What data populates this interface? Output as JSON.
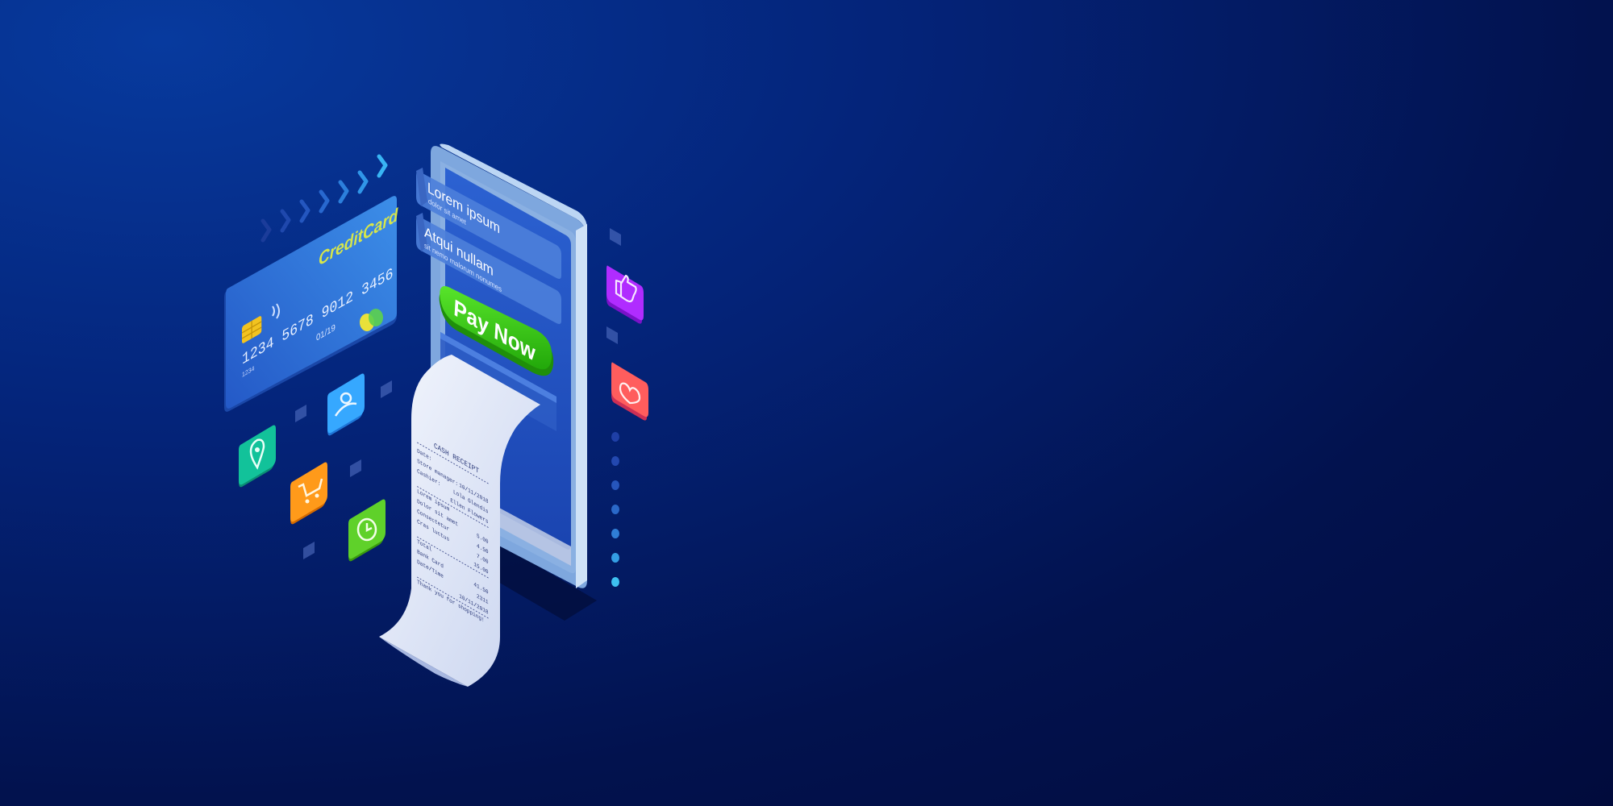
{
  "card": {
    "brand": "CreditCard",
    "number": "1234 5678 9012 3456",
    "expiry": "01/19",
    "small_code": "1234"
  },
  "phone": {
    "field1_title": "Lorem ipsum",
    "field1_sub": "dolor sit amet",
    "field2_title": "Atqui nullam",
    "field2_sub": "sit nemo malorum nonumes",
    "pay_button": "Pay Now"
  },
  "receipt": {
    "title": "CASH RECEIPT",
    "lines": [
      {
        "left": "Date:",
        "right": ""
      },
      {
        "left": "Store manager:",
        "right": "10/11/2018"
      },
      {
        "left": "Cashier:",
        "right": "Lola Glendis"
      },
      {
        "left": "",
        "right": "Ellen Flowers"
      },
      {
        "left": "Lorem ipsum",
        "right": ""
      },
      {
        "left": "Dolor sit amet",
        "right": "5.00"
      },
      {
        "left": "Consectetur",
        "right": "4.50"
      },
      {
        "left": "Cras luctus",
        "right": "7.00"
      },
      {
        "left": "",
        "right": "15.00"
      },
      {
        "left": "Total",
        "right": ""
      },
      {
        "left": "Bank Card",
        "right": "41.50"
      },
      {
        "left": "Date/Time",
        "right": "2311"
      },
      {
        "left": "",
        "right": "10/11/2018"
      },
      {
        "left": "Thank you for shopping!",
        "right": ""
      }
    ]
  },
  "icons": [
    {
      "name": "location-pin-icon",
      "color": "#12c29a"
    },
    {
      "name": "shopping-cart-icon",
      "color": "#ff9a1a"
    },
    {
      "name": "user-icon",
      "color": "#36a8ff"
    },
    {
      "name": "clock-icon",
      "color": "#5fd12a"
    },
    {
      "name": "thumbs-up-icon",
      "color": "#b02cff"
    },
    {
      "name": "heart-icon",
      "color": "#ff5d5d"
    }
  ],
  "colors": {
    "background": "#03186a",
    "pay_button": "#34c90f",
    "card": "#2b6fd8",
    "phone_screen": "#1f4fc0",
    "receipt": "#e4eaf8"
  }
}
